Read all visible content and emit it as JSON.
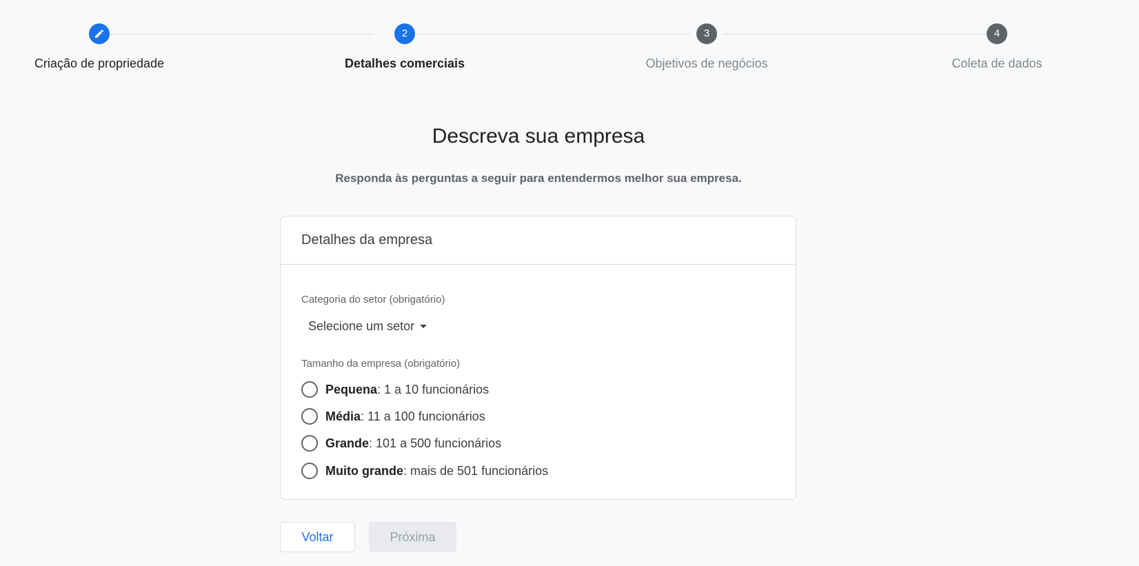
{
  "stepper": {
    "steps": [
      {
        "number": "",
        "label": "Criação de propriedade",
        "state": "done"
      },
      {
        "number": "2",
        "label": "Detalhes comerciais",
        "state": "current"
      },
      {
        "number": "3",
        "label": "Objetivos de negócios",
        "state": "future"
      },
      {
        "number": "4",
        "label": "Coleta de dados",
        "state": "future"
      }
    ]
  },
  "page": {
    "title": "Descreva sua empresa",
    "subtitle": "Responda às perguntas a seguir para entendermos melhor sua empresa."
  },
  "card": {
    "header": "Detalhes da empresa",
    "industry": {
      "label": "Categoria do setor (obrigatório)",
      "selected": "Selecione um setor"
    },
    "size": {
      "label": "Tamanho da empresa (obrigatório)",
      "options": [
        {
          "name": "Pequena",
          "detail": ": 1 a 10 funcionários"
        },
        {
          "name": "Média",
          "detail": ": 11 a 100 funcionários"
        },
        {
          "name": "Grande",
          "detail": ": 101 a 500 funcionários"
        },
        {
          "name": "Muito grande",
          "detail": ": mais de 501 funcionários"
        }
      ]
    }
  },
  "buttons": {
    "back": "Voltar",
    "next": "Próxima"
  },
  "colors": {
    "accent": "#1a73e8",
    "inactive_step": "#5f6368",
    "background": "#f8f9fa"
  }
}
